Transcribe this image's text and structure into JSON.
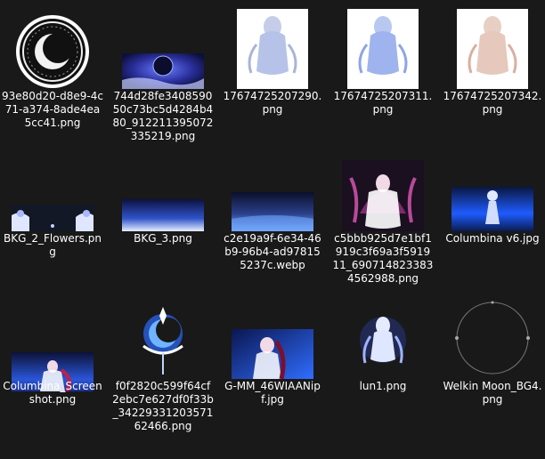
{
  "files": [
    {
      "name": "93e80d20-d8e9-4c71-a374-8ade4ea5cc41.png",
      "icon": "moon-emblem-image-icon"
    },
    {
      "name": "744d28fe340859050c73bc5d4284b480_912211395072335219.png",
      "icon": "night-moon-banner-image-icon"
    },
    {
      "name": "17674725207290.png",
      "icon": "spirit-figure-image-icon"
    },
    {
      "name": "17674725207311.png",
      "icon": "spirit-figure-image-icon"
    },
    {
      "name": "17674725207342.png",
      "icon": "spirit-figure-image-icon"
    },
    {
      "name": "BKG_2_Flowers.png",
      "icon": "flowers-border-image-icon"
    },
    {
      "name": "BKG_3.png",
      "icon": "blue-gradient-image-icon"
    },
    {
      "name": "c2e19a9f-6e34-46b9-96b4-ad978155237c.webp",
      "icon": "night-field-image-icon"
    },
    {
      "name": "c5bbb925d7e1bf1919c3f69a3f591911_690714823383 4562988.png",
      "icon": "character-art-image-icon"
    },
    {
      "name": "Columbina v6.jpg",
      "icon": "moonlit-scene-image-icon"
    },
    {
      "name": "Columbina_Screenshot.png",
      "icon": "screenshot-image-icon"
    },
    {
      "name": "f0f2820c599f64cf2ebc7e627df0f33b_3422933120357162466.png",
      "icon": "moon-crest-image-icon"
    },
    {
      "name": "G-MM_46WIAANipf.jpg",
      "icon": "character-poster-image-icon"
    },
    {
      "name": "lun1.png",
      "icon": "glowing-spirit-image-icon"
    },
    {
      "name": "Welkin Moon_BG4.png",
      "icon": "moon-ring-image-icon"
    }
  ]
}
